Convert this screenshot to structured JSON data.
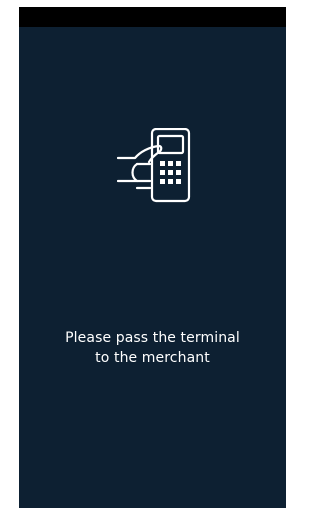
{
  "screen": {
    "background_color": "#0d2032",
    "status_bar_color": "#000000",
    "icon": "card-terminal-hand-icon",
    "message_line_1": "Please pass the terminal",
    "message_line_2": "to the merchant"
  }
}
